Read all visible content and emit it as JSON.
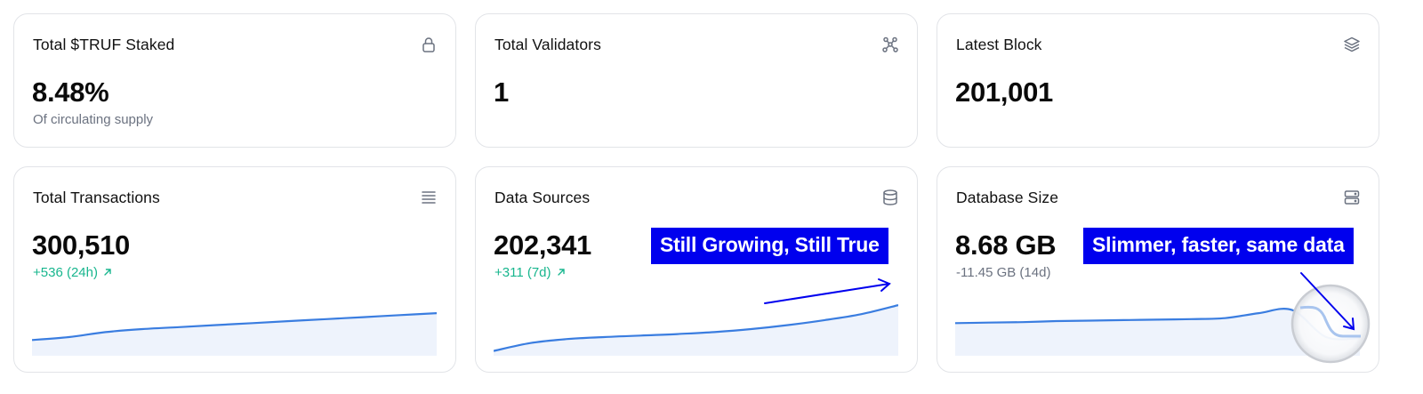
{
  "cards": {
    "staked": {
      "title": "Total $TRUF Staked",
      "value": "8.48%",
      "sub": "Of circulating supply",
      "icon": "lock-icon"
    },
    "validators": {
      "title": "Total Validators",
      "value": "1",
      "icon": "network-nodes-icon"
    },
    "block": {
      "title": "Latest Block",
      "value": "201,001",
      "icon": "layers-icon"
    },
    "transactions": {
      "title": "Total Transactions",
      "value": "300,510",
      "sub": "+536 (24h)",
      "icon": "list-icon"
    },
    "sources": {
      "title": "Data Sources",
      "value": "202,341",
      "sub": "+311 (7d)",
      "icon": "database-icon",
      "callout": "Still Growing, Still True"
    },
    "dbsize": {
      "title": "Database Size",
      "value": "8.68 GB",
      "sub": "-11.45 GB (14d)",
      "icon": "server-icon",
      "callout": "Slimmer, faster, same data"
    }
  },
  "colors": {
    "accent_line": "#3a7de0",
    "area_fill": "#eef3fc",
    "positive": "#18b68e",
    "muted": "#6b7280",
    "callout_bg": "#0000ee",
    "border": "#e2e4e8"
  },
  "sparklines": {
    "transactions": [
      0.28,
      0.34,
      0.44,
      0.5,
      0.54,
      0.58,
      0.62,
      0.66,
      0.7,
      0.74,
      0.78,
      0.82
    ],
    "sources": [
      0.06,
      0.22,
      0.3,
      0.34,
      0.37,
      0.4,
      0.44,
      0.5,
      0.58,
      0.68,
      0.8,
      0.98
    ],
    "dbsize": [
      0.62,
      0.63,
      0.64,
      0.66,
      0.67,
      0.68,
      0.69,
      0.7,
      0.72,
      0.82,
      0.88,
      0.34,
      0.32
    ]
  }
}
